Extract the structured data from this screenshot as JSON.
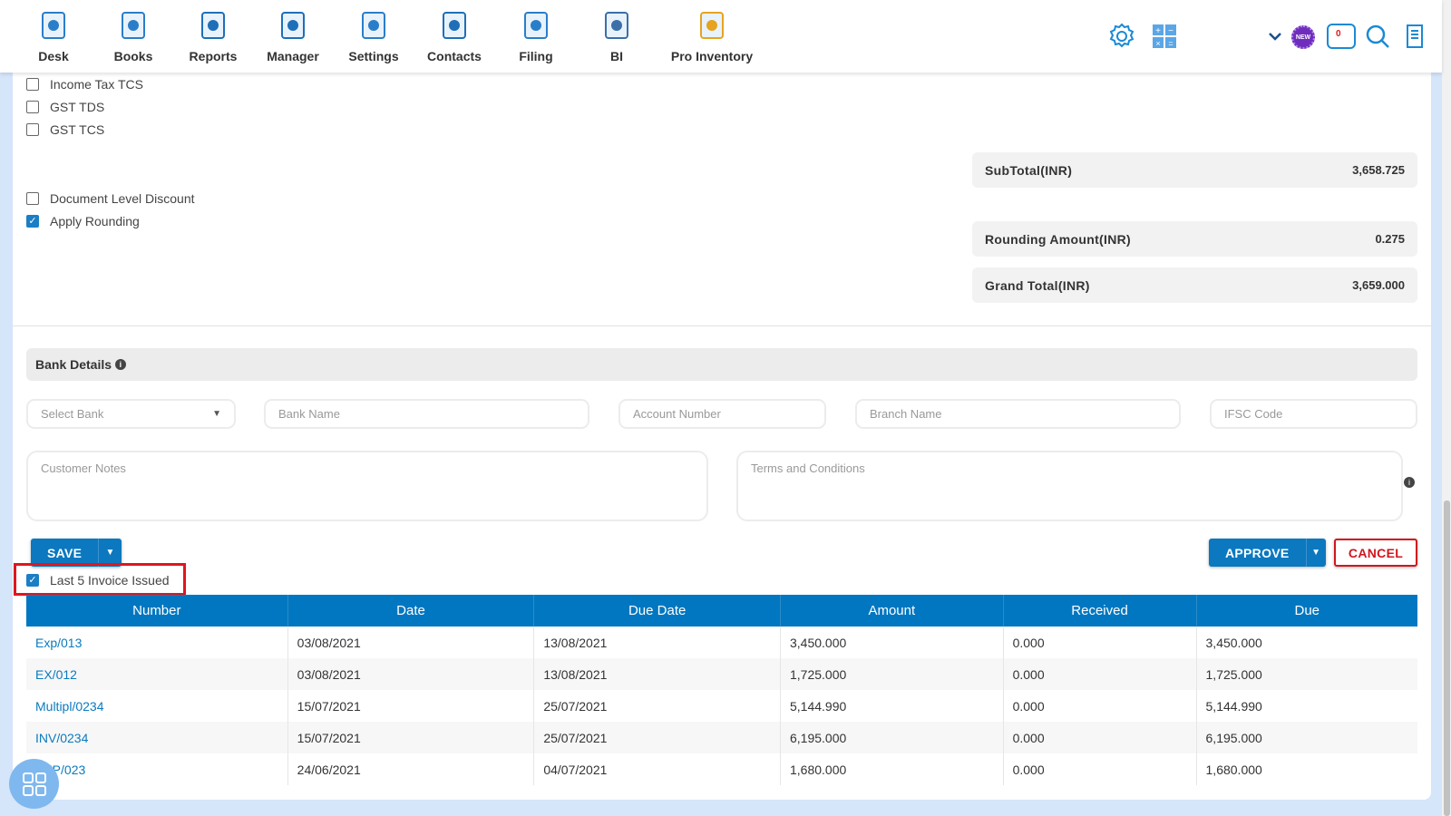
{
  "nav": [
    {
      "label": "Desk",
      "icon": "desk-icon"
    },
    {
      "label": "Books",
      "icon": "books-icon"
    },
    {
      "label": "Reports",
      "icon": "reports-icon"
    },
    {
      "label": "Manager",
      "icon": "manager-icon"
    },
    {
      "label": "Settings",
      "icon": "settings-tools-icon"
    },
    {
      "label": "Contacts",
      "icon": "contacts-icon"
    },
    {
      "label": "Filing",
      "icon": "filing-icon"
    },
    {
      "label": "BI",
      "icon": "bi-robot-icon"
    },
    {
      "label": "Pro Inventory",
      "icon": "inventory-icon"
    }
  ],
  "toolbar": {
    "notification_count": "0",
    "new_badge": "NEW"
  },
  "options": [
    {
      "label": "Income Tax TCS",
      "checked": false
    },
    {
      "label": "GST TDS",
      "checked": false
    },
    {
      "label": "GST TCS",
      "checked": false
    },
    {
      "label": "Document Level Discount",
      "checked": false
    },
    {
      "label": "Apply Rounding",
      "checked": true
    }
  ],
  "summary": {
    "subtotal_label": "SubTotal(INR)",
    "subtotal": "3,658.725",
    "rounding_label": "Rounding Amount(INR)",
    "rounding": "0.275",
    "grand_label": "Grand Total(INR)",
    "grand": "3,659.000"
  },
  "bank": {
    "title": "Bank Details",
    "select_bank": "Select Bank",
    "bank_name": "Bank Name",
    "account_number": "Account Number",
    "branch_name": "Branch Name",
    "ifsc": "IFSC Code",
    "customer_notes": "Customer Notes",
    "terms": "Terms and Conditions"
  },
  "actions": {
    "save": "SAVE",
    "approve": "APPROVE",
    "cancel": "CANCEL"
  },
  "last_invoices": {
    "label": "Last 5 Invoice Issued",
    "checked": true,
    "columns": [
      "Number",
      "Date",
      "Due Date",
      "Amount",
      "Received",
      "Due"
    ],
    "rows": [
      [
        "Exp/013",
        "03/08/2021",
        "13/08/2021",
        "3,450.000",
        "0.000",
        "3,450.000"
      ],
      [
        "EX/012",
        "03/08/2021",
        "13/08/2021",
        "1,725.000",
        "0.000",
        "1,725.000"
      ],
      [
        "Multipl/0234",
        "15/07/2021",
        "25/07/2021",
        "5,144.990",
        "0.000",
        "5,144.990"
      ],
      [
        "INV/0234",
        "15/07/2021",
        "25/07/2021",
        "6,195.000",
        "0.000",
        "6,195.000"
      ],
      [
        "EXP/023",
        "24/06/2021",
        "04/07/2021",
        "1,680.000",
        "0.000",
        "1,680.000"
      ]
    ]
  },
  "colors": {
    "primary": "#0077c0",
    "cancel": "#d0161e",
    "highlight": "#e0161e",
    "link": "#0a7bbf"
  }
}
